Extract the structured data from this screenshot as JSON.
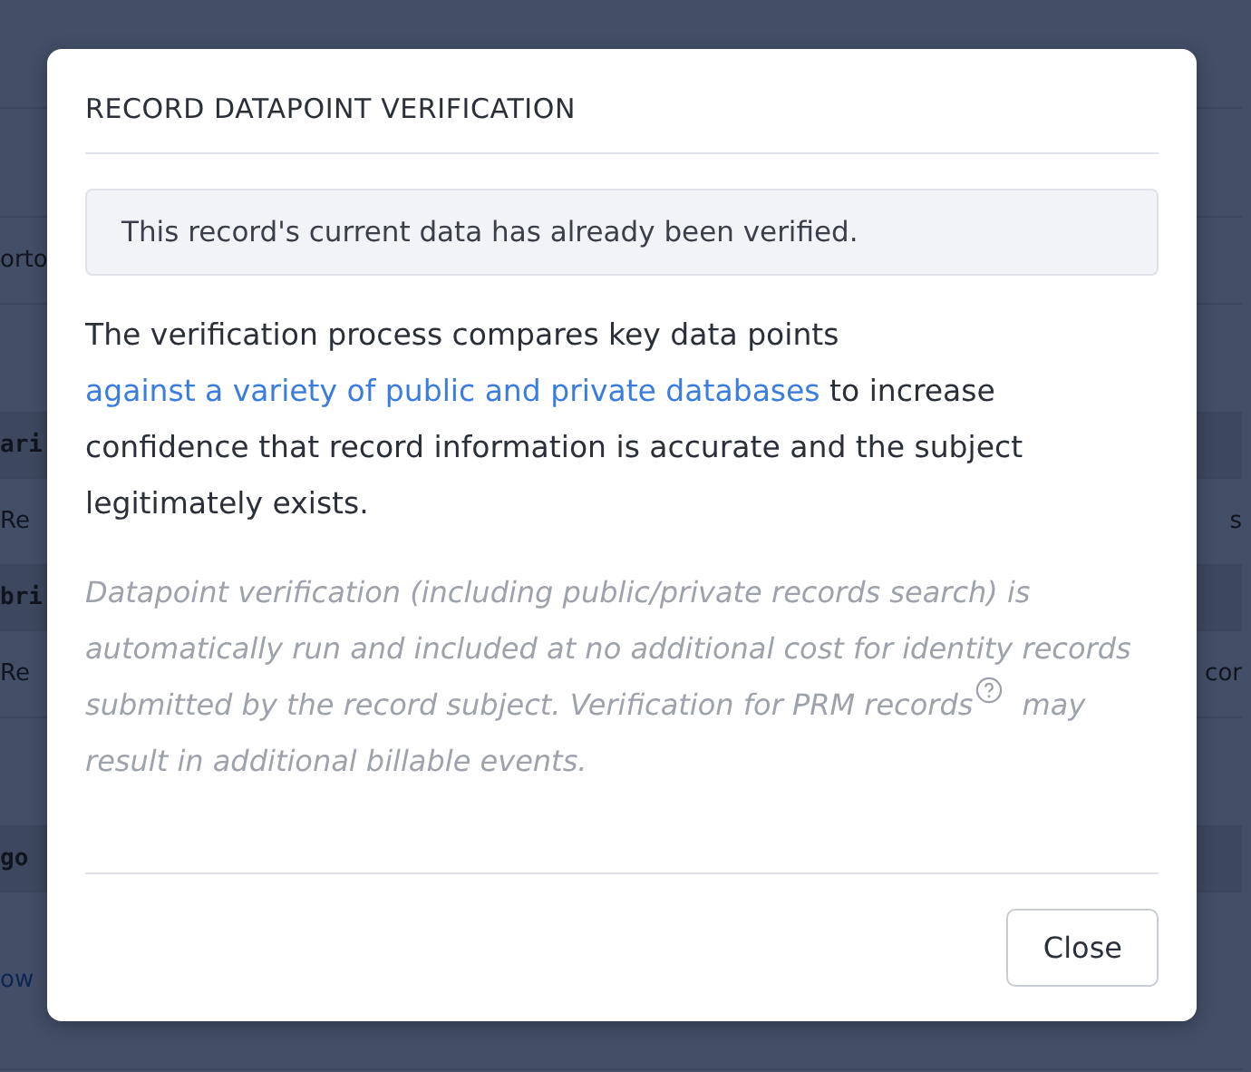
{
  "background_rows": [
    {
      "kind": "blank",
      "left": "",
      "right": ""
    },
    {
      "kind": "blank",
      "left": "",
      "right": ""
    },
    {
      "kind": "text",
      "left": "orto",
      "right": ""
    },
    {
      "kind": "blank",
      "left": "",
      "right": ""
    },
    {
      "kind": "band",
      "left": "ari",
      "right": ""
    },
    {
      "kind": "text",
      "left": "Re",
      "right": "s"
    },
    {
      "kind": "band",
      "left": "bri",
      "right": ""
    },
    {
      "kind": "text",
      "left": "Re",
      "right": "cor"
    },
    {
      "kind": "blank",
      "left": "",
      "right": ""
    },
    {
      "kind": "band",
      "left": "go",
      "right": ""
    },
    {
      "kind": "link",
      "left": "ow",
      "right": ""
    }
  ],
  "modal": {
    "title": "RECORD DATAPOINT VERIFICATION",
    "alert": "This record's current data has already been verified.",
    "paragraph": {
      "before": "The verification process compares key data points ",
      "link": "against a variety of public and private databases",
      "after": " to increase confidence that record information is accurate and the subject legitimately exists."
    },
    "note": {
      "before": "Datapoint verification (including public/private records search) is automatically run and included at no additional cost for identity records submitted by the record subject. Verification for PRM records",
      "after": " may result in additional billable events."
    },
    "buttons": [
      "Close"
    ]
  }
}
